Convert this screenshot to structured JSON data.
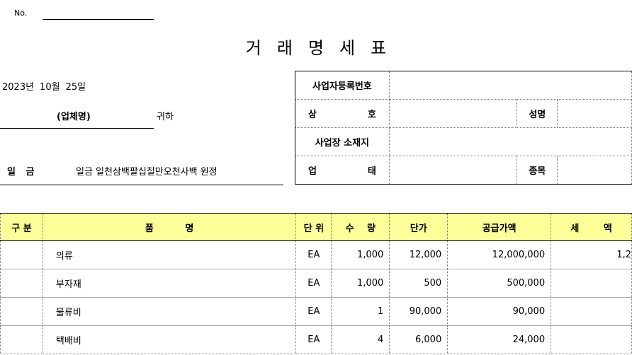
{
  "header": {
    "no_label": "No.",
    "title_chars": [
      "거",
      "래",
      "명",
      "세",
      "표"
    ],
    "date": {
      "year": "2023년",
      "month": "10월",
      "day": "25일"
    },
    "recipient": "(업체명)",
    "honorific": "귀하",
    "amount_label": "일 금",
    "amount_text": "일금 일천삼백팔십칠만오천사백 원정"
  },
  "supplier": {
    "reg_no_label": "사업자등록번호",
    "trade_name_label": "상 호",
    "name_label": "성명",
    "address_label": "사업장 소재지",
    "business_type_label": "업 태",
    "business_item_label": "종목"
  },
  "items": {
    "columns": [
      "구 분",
      "품 명",
      "단 위",
      "수 량",
      "단가",
      "공급가액",
      "세 액"
    ],
    "rows": [
      {
        "category": "",
        "name": "의류",
        "unit": "EA",
        "qty": "1,000",
        "price": "12,000",
        "supply": "12,000,000",
        "tax": "1,2"
      },
      {
        "category": "",
        "name": "부자재",
        "unit": "EA",
        "qty": "1,000",
        "price": "500",
        "supply": "500,000",
        "tax": ""
      },
      {
        "category": "",
        "name": "물류비",
        "unit": "EA",
        "qty": "1",
        "price": "90,000",
        "supply": "90,000",
        "tax": ""
      },
      {
        "category": "",
        "name": "택배비",
        "unit": "EA",
        "qty": "4",
        "price": "6,000",
        "supply": "24,000",
        "tax": ""
      }
    ]
  }
}
